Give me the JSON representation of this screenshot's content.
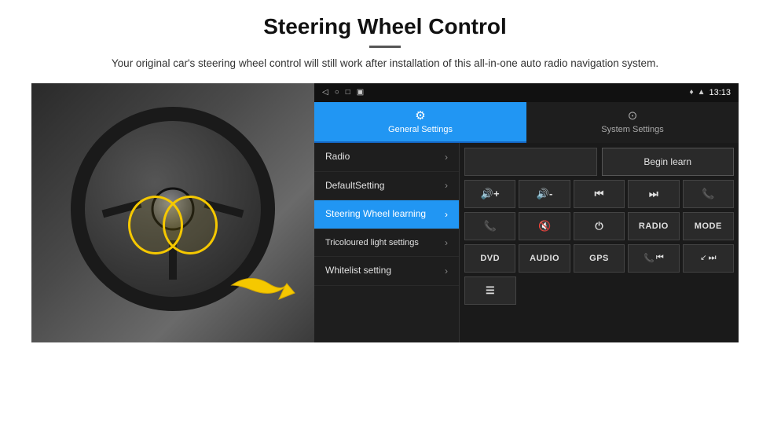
{
  "header": {
    "title": "Steering Wheel Control",
    "divider": true,
    "subtitle": "Your original car's steering wheel control will still work after installation of this all-in-one auto radio navigation system."
  },
  "status_bar": {
    "left_icons": [
      "◁",
      "○",
      "□",
      "▣"
    ],
    "right_text": "13:13",
    "right_icons": [
      "♦",
      "▲"
    ]
  },
  "tabs": [
    {
      "label": "General Settings",
      "icon": "⚙",
      "active": true
    },
    {
      "label": "System Settings",
      "icon": "🔄",
      "active": false
    }
  ],
  "menu": {
    "items": [
      {
        "label": "Radio",
        "active": false
      },
      {
        "label": "DefaultSetting",
        "active": false
      },
      {
        "label": "Steering Wheel learning",
        "active": true
      },
      {
        "label": "Tricoloured light settings",
        "active": false
      },
      {
        "label": "Whitelist setting",
        "active": false
      }
    ]
  },
  "controls": {
    "begin_learn_label": "Begin learn",
    "row1": [
      {
        "icon": "🔊+",
        "type": "icon"
      },
      {
        "icon": "🔊-",
        "type": "icon"
      },
      {
        "icon": "⏮",
        "type": "icon"
      },
      {
        "icon": "⏭",
        "type": "icon"
      },
      {
        "icon": "📞",
        "type": "icon"
      }
    ],
    "row2": [
      {
        "icon": "📞↙",
        "type": "icon"
      },
      {
        "icon": "🔇",
        "type": "icon"
      },
      {
        "icon": "⏻",
        "type": "icon"
      },
      {
        "label": "RADIO",
        "type": "text"
      },
      {
        "label": "MODE",
        "type": "text"
      }
    ],
    "row3": [
      {
        "label": "DVD",
        "type": "text"
      },
      {
        "label": "AUDIO",
        "type": "text"
      },
      {
        "label": "GPS",
        "type": "text"
      },
      {
        "icon": "📞⏮",
        "type": "combined"
      },
      {
        "icon": "↙⏭",
        "type": "combined"
      }
    ],
    "row4": [
      {
        "icon": "📋",
        "type": "icon"
      }
    ]
  }
}
